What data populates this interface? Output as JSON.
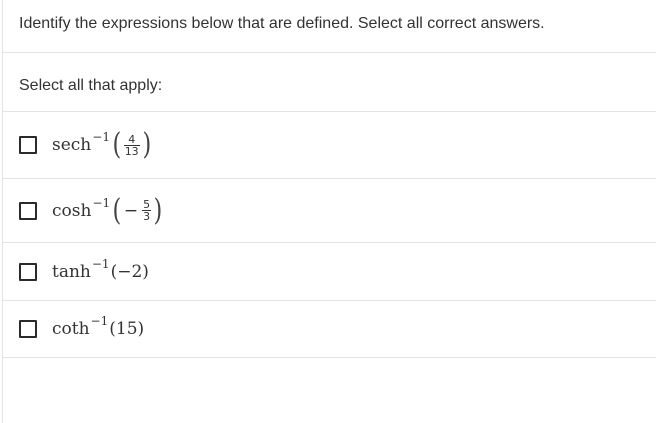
{
  "question": "Identify the expressions below that are defined. Select all correct answers.",
  "instruction": "Select all that apply:",
  "options": [
    {
      "fn": "sech",
      "exp": "−1",
      "sign": "",
      "num": "4",
      "den": "13",
      "arg": "",
      "checked": false
    },
    {
      "fn": "cosh",
      "exp": "−1",
      "sign": "−",
      "num": "5",
      "den": "3",
      "arg": "",
      "checked": false
    },
    {
      "fn": "tanh",
      "exp": "−1",
      "arg": "(−2)",
      "checked": false
    },
    {
      "fn": "coth",
      "exp": "−1",
      "arg": "(15)",
      "checked": false
    }
  ]
}
